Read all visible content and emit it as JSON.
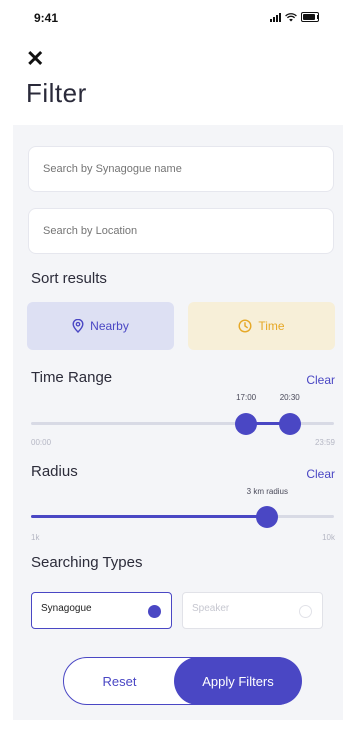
{
  "status_bar": {
    "time": "9:41"
  },
  "header": {
    "title": "Filter",
    "close_icon": "close-icon"
  },
  "search": {
    "synagogue_placeholder": "Search by Synagogue name",
    "location_placeholder": "Search by Location"
  },
  "sort": {
    "label": "Sort results",
    "options": [
      {
        "label": "Nearby",
        "icon": "location-pin-icon",
        "selected": true
      },
      {
        "label": "Time",
        "icon": "clock-icon",
        "selected": false
      }
    ]
  },
  "time_range": {
    "label": "Time Range",
    "clear": "Clear",
    "min_label": "00:00",
    "max_label": "23:59",
    "start": "17:00",
    "end": "20:30",
    "start_fraction": 0.71,
    "end_fraction": 0.854
  },
  "radius": {
    "label": "Radius",
    "clear": "Clear",
    "value_label": "3 km radius",
    "min_label": "1k",
    "max_label": "10k",
    "fraction": 0.78
  },
  "searching_types": {
    "label": "Searching Types",
    "options": [
      {
        "label": "Synagogue",
        "selected": true
      },
      {
        "label": "Speaker",
        "selected": false
      }
    ]
  },
  "actions": {
    "reset": "Reset",
    "apply": "Apply Filters"
  },
  "colors": {
    "accent": "#4A47C4",
    "time_accent": "#E6A826",
    "panel_bg": "#F4F5F8"
  }
}
